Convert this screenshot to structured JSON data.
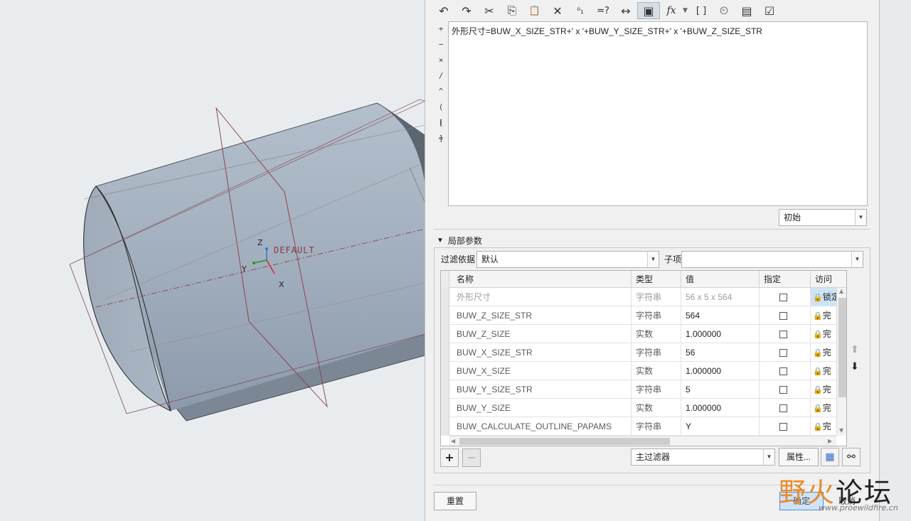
{
  "viewport": {
    "csys_label": "DEFAULT",
    "axis_z": "Z",
    "axis_y": "Y",
    "axis_x": "X"
  },
  "toolbar": {
    "icons": [
      "undo-icon",
      "redo-icon",
      "cut-icon",
      "copy-icon",
      "paste-icon",
      "delete-icon",
      "units-icon",
      "evaluate-icon",
      "dimension-icon",
      "show-values-icon",
      "function-icon",
      "brackets-icon",
      "sort-icon",
      "verify-icon",
      "checklist-icon"
    ],
    "glyphs": [
      "↶",
      "↷",
      "✂",
      "⎘",
      "📋",
      "✕",
      "⁰₁",
      "=?",
      "↔",
      "▣",
      "fx",
      "[ ]",
      "⏲",
      "▤",
      "☑"
    ]
  },
  "operators": [
    "+",
    "−",
    "×",
    "/",
    "^",
    "( )",
    "[ ]",
    "="
  ],
  "relations_text": "外形尺寸=BUW_X_SIZE_STR+' x '+BUW_Y_SIZE_STR+' x '+BUW_Z_SIZE_STR",
  "initial_combo": {
    "value": "初始"
  },
  "local_params": {
    "title": "局部参数",
    "filter_label": "过滤依据",
    "filter_value": "默认",
    "child_label": "子项",
    "child_value": "",
    "columns": [
      "名称",
      "类型",
      "值",
      "指定",
      "访问"
    ],
    "rows": [
      {
        "name": "外形尺寸",
        "type": "字符串",
        "value": "56 x 5 x 564",
        "access": "锁定",
        "dim": true
      },
      {
        "name": "BUW_Z_SIZE_STR",
        "type": "字符串",
        "value": "564",
        "access": "完",
        "dim": false
      },
      {
        "name": "BUW_Z_SIZE",
        "type": "实数",
        "value": "1.000000",
        "access": "完",
        "dim": false
      },
      {
        "name": "BUW_X_SIZE_STR",
        "type": "字符串",
        "value": "56",
        "access": "完",
        "dim": false
      },
      {
        "name": "BUW_X_SIZE",
        "type": "实数",
        "value": "1.000000",
        "access": "完",
        "dim": false
      },
      {
        "name": "BUW_Y_SIZE_STR",
        "type": "字符串",
        "value": "5",
        "access": "完",
        "dim": false
      },
      {
        "name": "BUW_Y_SIZE",
        "type": "实数",
        "value": "1.000000",
        "access": "完",
        "dim": false
      },
      {
        "name": "BUW_CALCULATE_OUTLINE_PAPAMS",
        "type": "字符串",
        "value": "Y",
        "access": "完",
        "dim": false
      }
    ],
    "main_filter": "主过滤器",
    "properties_button": "属性..."
  },
  "buttons": {
    "reset": "重置",
    "ok": "确定",
    "cancel": "取消"
  },
  "watermark": {
    "part_a": "野火",
    "part_b": "论坛",
    "url": "www.proewildfire.cn"
  }
}
